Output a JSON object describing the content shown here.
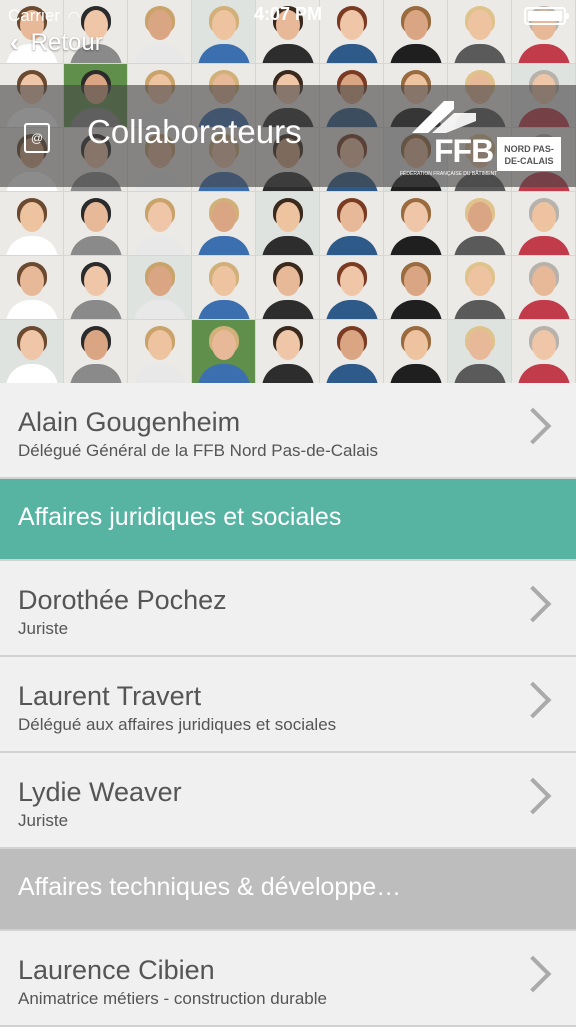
{
  "status": {
    "carrier": "Carrier",
    "time": "4:07 PM"
  },
  "nav": {
    "back_label": "Retour"
  },
  "header": {
    "title": "Collaborateurs",
    "logo": {
      "brand": "FFB",
      "sub": "FÉDÉRATION FRANÇAISE DU BÂTIMENT",
      "region": "NORD PAS-DE-CALAIS"
    }
  },
  "list": {
    "top_contact": {
      "name": "Alain Gougenheim",
      "role": "Délégué Général de la FFB Nord Pas-de-Calais"
    },
    "sections": [
      {
        "label": "Affaires juridiques et sociales",
        "contacts": [
          {
            "name": "Dorothée Pochez",
            "role": "Juriste"
          },
          {
            "name": "Laurent Travert",
            "role": "Délégué aux affaires juridiques et sociales"
          },
          {
            "name": "Lydie Weaver",
            "role": "Juriste"
          }
        ]
      },
      {
        "label": "Affaires techniques & développe…",
        "contacts": [
          {
            "name": "Laurence Cibien",
            "role": "Animatrice métiers - construction durable"
          }
        ]
      }
    ]
  }
}
